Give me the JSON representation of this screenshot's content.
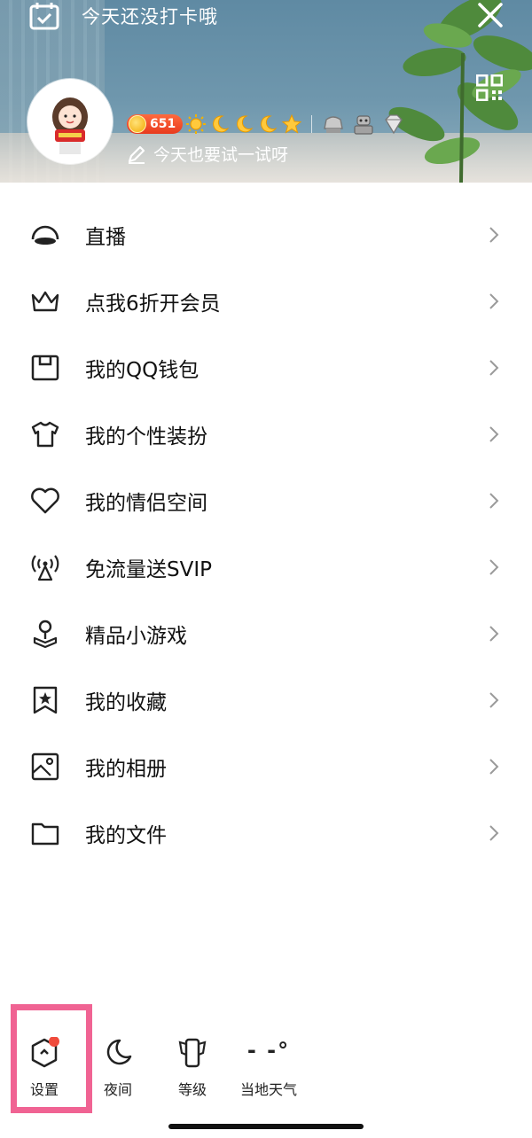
{
  "header": {
    "checkin_text": "今天还没打卡哦",
    "coin_count": "651",
    "signature": "今天也要试一试呀",
    "icons": [
      "calendar-check-icon",
      "close-icon",
      "qr-code-icon",
      "pen-icon"
    ]
  },
  "menu": {
    "items": [
      {
        "label": "直播",
        "icon": "live-icon"
      },
      {
        "label": "点我6折开会员",
        "icon": "crown-icon"
      },
      {
        "label": "我的QQ钱包",
        "icon": "wallet-icon"
      },
      {
        "label": "我的个性装扮",
        "icon": "shirt-icon"
      },
      {
        "label": "我的情侣空间",
        "icon": "heart-icon"
      },
      {
        "label": "免流量送SVIP",
        "icon": "signal-tower-icon"
      },
      {
        "label": "精品小游戏",
        "icon": "joystick-icon"
      },
      {
        "label": "我的收藏",
        "icon": "bookmark-star-icon"
      },
      {
        "label": "我的相册",
        "icon": "photo-icon"
      },
      {
        "label": "我的文件",
        "icon": "folder-icon"
      }
    ]
  },
  "bottom": {
    "settings_label": "设置",
    "night_label": "夜间",
    "level_label": "等级",
    "weather_label": "当地天气",
    "weather_temp": "- -°",
    "highlight_color": "#f06393",
    "badge_color": "#f04b3c"
  }
}
